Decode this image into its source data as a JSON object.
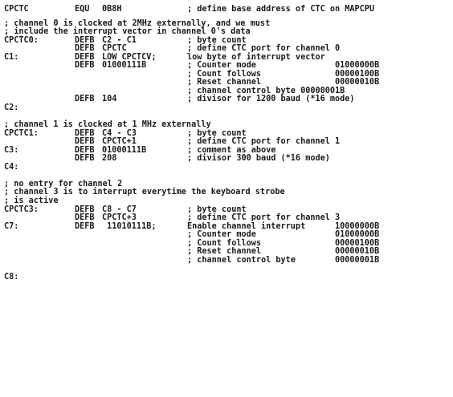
{
  "lines": [
    {
      "kind": "code",
      "label": "CPCTC",
      "op": "EQU",
      "arg": "0B8H",
      "comment": "; define base address of CTC on MAPCPU",
      "bin": ""
    },
    {
      "kind": "gap"
    },
    {
      "kind": "comment",
      "text": "; channel 0 is clocked at 2MHz externally, and we must"
    },
    {
      "kind": "comment",
      "text": "; include the interrupt vector in channel 0's data"
    },
    {
      "kind": "code",
      "label": "CPCTC0:",
      "op": "DEFB",
      "arg": "C2 - C1",
      "comment": "; byte count",
      "bin": ""
    },
    {
      "kind": "code",
      "label": "",
      "op": "DEFB",
      "arg": "CPCTC",
      "comment": "; define CTC port for channel 0",
      "bin": ""
    },
    {
      "kind": "code",
      "label": "C1:",
      "op": "DEFB",
      "arg": "LOW CPCTCV;",
      "comment": "low byte of interrupt vector",
      "bin": ""
    },
    {
      "kind": "code",
      "label": "",
      "op": "DEFB",
      "arg": "01000111B",
      "comment": "; Counter mode",
      "bin": "01000000B"
    },
    {
      "kind": "code",
      "label": "",
      "op": "",
      "arg": "",
      "comment": "; Count follows",
      "bin": "00000100B"
    },
    {
      "kind": "code",
      "label": "",
      "op": "",
      "arg": "",
      "comment": "; Reset channel",
      "bin": "00000010B"
    },
    {
      "kind": "code",
      "label": "",
      "op": "",
      "arg": "",
      "comment": "; channel control byte 00000001B",
      "bin": ""
    },
    {
      "kind": "code",
      "label": "",
      "op": "DEFB",
      "arg": "104",
      "comment": "; divisor for 1200 baud (*16 mode)",
      "bin": ""
    },
    {
      "kind": "code",
      "label": "C2:",
      "op": "",
      "arg": "",
      "comment": "",
      "bin": ""
    },
    {
      "kind": "blank"
    },
    {
      "kind": "comment",
      "text": "; channel 1 is clocked at 1 MHz externally"
    },
    {
      "kind": "code",
      "label": "CPCTC1:",
      "op": "DEFB",
      "arg": "C4 - C3",
      "comment": "; byte count",
      "bin": ""
    },
    {
      "kind": "code",
      "label": "",
      "op": "DEFB",
      "arg": "CPCTC+1",
      "comment": "; define CTC port for channel 1",
      "bin": ""
    },
    {
      "kind": "code",
      "label": "C3:",
      "op": "DEFB",
      "arg": "01000111B",
      "comment": "; comment as above",
      "bin": ""
    },
    {
      "kind": "code",
      "label": "",
      "op": "DEFB",
      "arg": "208",
      "comment": "; divisor 300 baud (*16 mode)",
      "bin": ""
    },
    {
      "kind": "code",
      "label": "C4:",
      "op": "",
      "arg": "",
      "comment": "",
      "bin": ""
    },
    {
      "kind": "blank"
    },
    {
      "kind": "comment",
      "text": "; no entry for channel 2"
    },
    {
      "kind": "comment",
      "text": "; channel 3 is to interrupt everytime the keyboard strobe"
    },
    {
      "kind": "comment",
      "text": "; is active"
    },
    {
      "kind": "code",
      "label": "CPCTC3:",
      "op": "DEFB",
      "arg": "C8 - C7",
      "comment": "; byte count",
      "bin": ""
    },
    {
      "kind": "code",
      "label": "",
      "op": "DEFB",
      "arg": "CPCTC+3",
      "comment": "; define CTC port for channel 3",
      "bin": ""
    },
    {
      "kind": "code",
      "label": "C7:",
      "op": "DEFB",
      "arg": " 11010111B;",
      "comment": "Enable channel interrupt",
      "bin": "10000000B"
    },
    {
      "kind": "code",
      "label": "",
      "op": "",
      "arg": "",
      "comment": "; Counter mode",
      "bin": "01000000B"
    },
    {
      "kind": "code",
      "label": "",
      "op": "",
      "arg": "",
      "comment": "; Count follows",
      "bin": "00000100B"
    },
    {
      "kind": "code",
      "label": "",
      "op": "",
      "arg": "",
      "comment": "; Reset channel",
      "bin": "00000010B"
    },
    {
      "kind": "code",
      "label": "",
      "op": "",
      "arg": "",
      "comment": "; channel control byte",
      "bin": "00000001B"
    },
    {
      "kind": "blank"
    },
    {
      "kind": "code",
      "label": "C8:",
      "op": "",
      "arg": "",
      "comment": "",
      "bin": ""
    }
  ]
}
